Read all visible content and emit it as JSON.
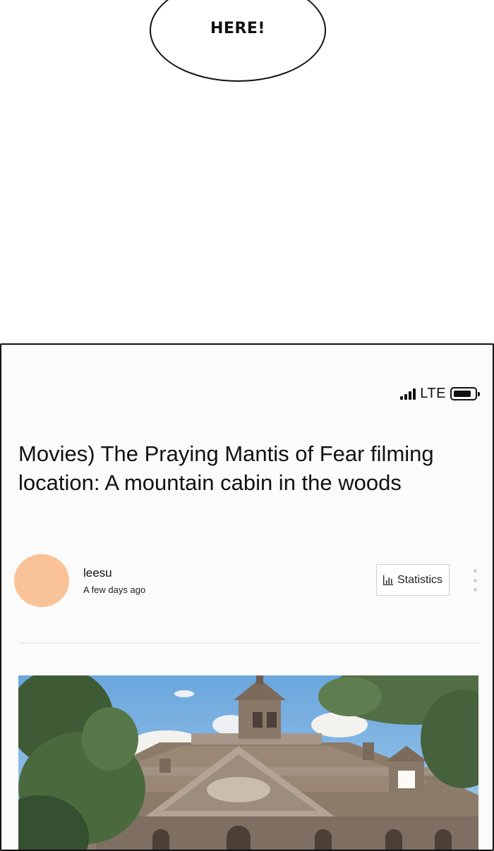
{
  "speech_bubble": {
    "text": "HERE!"
  },
  "phone": {
    "status_bar": {
      "network": "LTE",
      "icons": [
        "signal-icon",
        "battery-icon"
      ]
    },
    "post": {
      "title_line1": "Movies) The Praying Mantis of Fear filming",
      "title_line2": "location: A mountain cabin in the woods",
      "author": "leesu",
      "time": "A few days ago",
      "stats_label": "Statistics",
      "icons": [
        "bar-chart-icon",
        "more-vertical-icon"
      ]
    },
    "colors": {
      "avatar": "#f9c397",
      "panel_bg": "#fbfbfb",
      "sky": "#7fb6e6",
      "roof": "#8c7a69",
      "trees": "#3f5b35"
    }
  }
}
